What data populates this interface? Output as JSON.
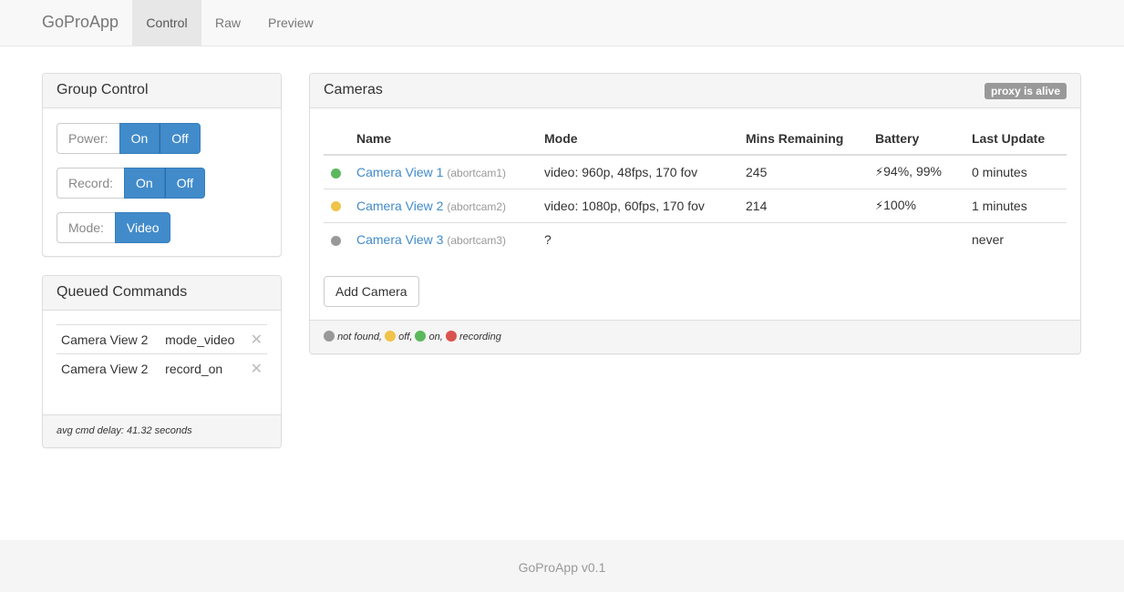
{
  "navbar": {
    "brand": "GoProApp",
    "tabs": [
      "Control",
      "Raw",
      "Preview"
    ]
  },
  "group_control": {
    "title": "Group Control",
    "power": {
      "label": "Power:",
      "on": "On",
      "off": "Off"
    },
    "record": {
      "label": "Record:",
      "on": "On",
      "off": "Off"
    },
    "mode": {
      "label": "Mode:",
      "value": "Video"
    }
  },
  "queued": {
    "title": "Queued Commands",
    "items": [
      {
        "camera": "Camera View 2",
        "command": "mode_video"
      },
      {
        "camera": "Camera View 2",
        "command": "record_on"
      }
    ],
    "close_glyph": "✕",
    "footer": "avg cmd delay: 41.32 seconds"
  },
  "cameras": {
    "title": "Cameras",
    "badge": "proxy is alive",
    "headers": [
      "Name",
      "Mode",
      "Mins Remaining",
      "Battery",
      "Last Update"
    ],
    "rows": [
      {
        "status_color": "#5cb85c",
        "name": "Camera View 1",
        "id": "(abortcam1)",
        "mode": "video: 960p, 48fps, 170 fov",
        "mins": "245",
        "battery": "94%, 99%",
        "update": "0 minutes"
      },
      {
        "status_color": "#f0c34a",
        "name": "Camera View 2",
        "id": "(abortcam2)",
        "mode": "video: 1080p, 60fps, 170 fov",
        "mins": "214",
        "battery": "100%",
        "update": "1 minutes"
      },
      {
        "status_color": "#999999",
        "name": "Camera View 3",
        "id": "(abortcam3)",
        "mode": "?",
        "mins": "",
        "battery": "",
        "update": "never"
      }
    ],
    "add_button": "Add Camera",
    "legend": {
      "not_found": "not found,",
      "off": "off,",
      "on": "on,",
      "recording": "recording"
    },
    "colors": {
      "not_found": "#999999",
      "off": "#f0c34a",
      "on": "#5cb85c",
      "recording": "#d9534f"
    }
  },
  "footer": {
    "text": "GoProApp v0.1"
  }
}
